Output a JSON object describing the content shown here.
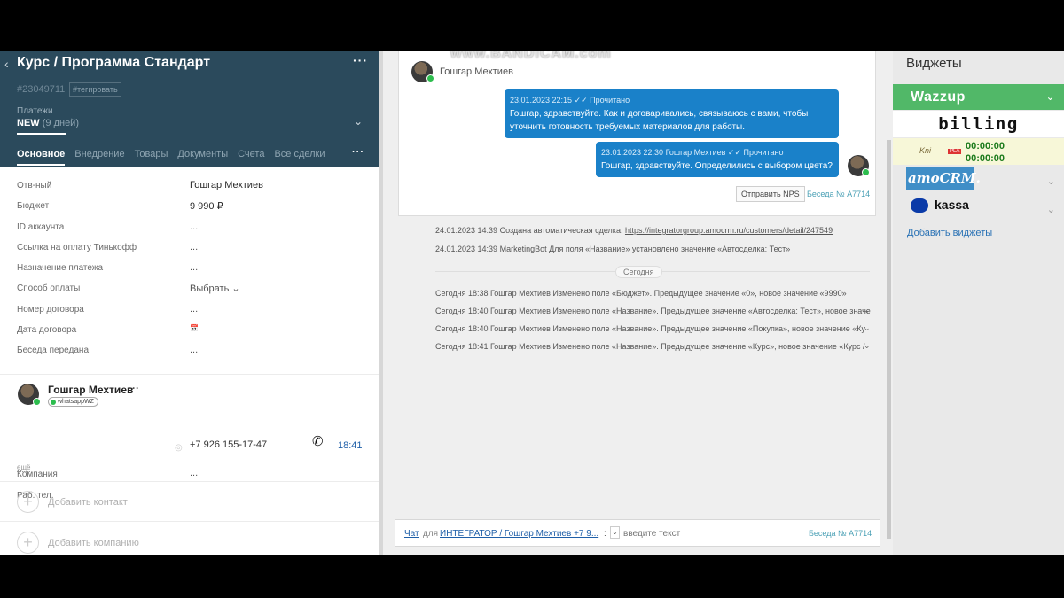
{
  "watermark": "www.BANDICAM.com",
  "deal": {
    "title": "Курс / Программа Стандарт",
    "id": "#23049711",
    "tag_button": "#тегировать",
    "pipeline_label": "Платежи",
    "status": "NEW",
    "status_days": "(9 дней)",
    "tabs": [
      "Основное",
      "Внедрение",
      "Товары",
      "Документы",
      "Счета",
      "Все сделки"
    ],
    "fields": [
      {
        "label": "Отв-ный",
        "value": "Гошгар Мехтиев"
      },
      {
        "label": "Бюджет",
        "value": "9 990 ₽"
      },
      {
        "label": "ID аккаунта",
        "value": "..."
      },
      {
        "label": "Ссылка на оплату Тинькофф",
        "value": "..."
      },
      {
        "label": "Назначение платежа",
        "value": "..."
      },
      {
        "label": "Способ оплаты",
        "value": "Выбрать"
      },
      {
        "label": "Номер договора",
        "value": "..."
      },
      {
        "label": "Дата договора",
        "value": "📅"
      },
      {
        "label": "Беседа передана",
        "value": "..."
      }
    ]
  },
  "contact": {
    "name": "Гошгар Мехтиев",
    "tag": "whatsappWZ",
    "company_label": "Компания",
    "company_value": "...",
    "phone_label": "Раб. тел.",
    "phone_value": "+7 926 155-17-47",
    "call_time": "18:41",
    "more": "ещё",
    "add_contact": "Добавить контакт",
    "add_company": "Добавить компанию"
  },
  "chat": {
    "sender": "Гошгар Мехтиев",
    "messages": [
      {
        "meta": "23.01.2023 22:15 ✓✓ Прочитано",
        "text": "Гошгар, здравствуйте. Как и договаривались, связываюсь с вами, чтобы уточнить готовность требуемых материалов для работы."
      },
      {
        "meta": "23.01.2023 22:30 Гошгар Мехтиев ✓✓ Прочитано",
        "text": "Гошгар, здравствуйте. Определились с выбором цвета?"
      }
    ],
    "nps_button": "Отправить NPS",
    "beseda": "Беседа № А7714"
  },
  "events": [
    {
      "prefix": "24.01.2023 14:39 Создана автоматическая сделка: ",
      "link": "https://integratorgroup.amocrm.ru/customers/detail/247549"
    },
    {
      "text": "24.01.2023 14:39 MarketingBot Для поля «Название» установлено значение «Автосделка: Тест»"
    },
    {
      "text": "Сегодня"
    },
    {
      "text": "Сегодня 18:38 Гошгар Мехтиев Изменено поле «Бюджет». Предыдущее значение «0», новое значение «9990»"
    },
    {
      "text": "Сегодня 18:40 Гошгар Мехтиев Изменено поле «Название». Предыдущее значение «Автосделка: Тест», новое значе"
    },
    {
      "text": "Сегодня 18:40 Гошгар Мехтиев Изменено поле «Название». Предыдущее значение «Покупка», новое значение «Ку"
    },
    {
      "text": "Сегодня 18:41 Гошгар Мехтиев Изменено поле «Название». Предыдущее значение «Курс», новое значение «Курс /"
    }
  ],
  "input": {
    "chat": "Чат",
    "for": "для",
    "target": "ИНТЕГРАТОР / Гошгар Мехтиев +7 9...",
    "separator": ":",
    "placeholder": "введите текст",
    "beseda": "Беседа № А7714"
  },
  "widgets": {
    "title": "Виджеты",
    "wazzup": "Wazzup",
    "billing": "billing",
    "timer_1": "00:00:00",
    "timer_2": "00:00:00",
    "amocrm": "amoCRM.",
    "kassa": "kassa",
    "add": "Добавить виджеты"
  },
  "colors": {
    "header": "#2b4a5c",
    "bubble": "#1a81c9",
    "wazzup": "#51b868",
    "link": "#1f5fa8"
  }
}
